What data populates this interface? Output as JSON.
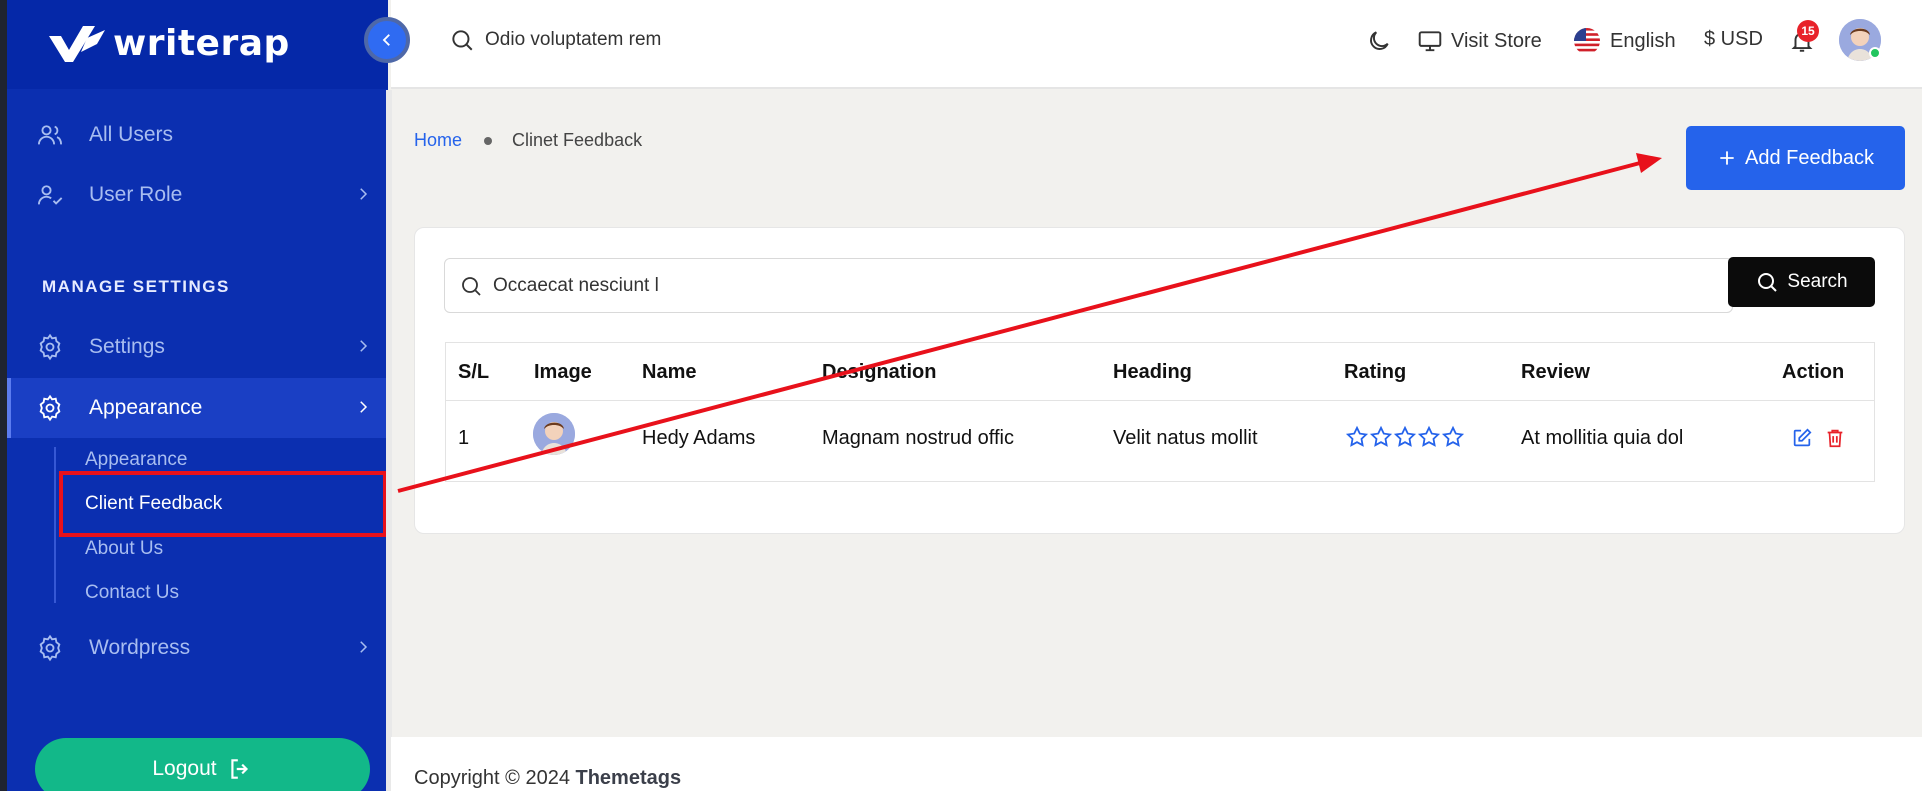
{
  "brand": {
    "name": "writerap"
  },
  "sidebar": {
    "items": [
      {
        "label": "All Users",
        "icon": "users-icon"
      },
      {
        "label": "User Role",
        "icon": "user-check-icon"
      },
      {
        "label": "Settings",
        "icon": "gear-icon"
      },
      {
        "label": "Appearance",
        "icon": "gear-icon"
      },
      {
        "label": "Wordpress",
        "icon": "gear-icon"
      }
    ],
    "section_title": "MANAGE SETTINGS",
    "submenu": [
      "Appearance",
      "Client Feedback",
      "About Us",
      "Contact Us"
    ],
    "logout_label": "Logout"
  },
  "topbar": {
    "search_text": "Odio voluptatem rem",
    "visit_store": "Visit Store",
    "language": "English",
    "currency": "$ USD",
    "notification_count": "15"
  },
  "breadcrumb": {
    "home": "Home",
    "current": "Clinet Feedback"
  },
  "add_button": "Add Feedback",
  "search": {
    "value": "Occaecat nesciunt l",
    "button": "Search"
  },
  "table": {
    "headers": [
      "S/L",
      "Image",
      "Name",
      "Designation",
      "Heading",
      "Rating",
      "Review",
      "Action"
    ],
    "rows": [
      {
        "sl": "1",
        "name": "Hedy Adams",
        "designation": "Magnam nostrud offic",
        "heading": "Velit natus mollit",
        "rating": 0,
        "review": "At mollitia quia dol"
      }
    ]
  },
  "footer": {
    "prefix": "Copyright © 2024",
    "company": "Themetags"
  },
  "colors": {
    "sidebar": "#0b2fb0",
    "primary": "#2563eb",
    "logout": "#12b889",
    "danger": "#e8222a",
    "annotation": "#e8111b"
  }
}
